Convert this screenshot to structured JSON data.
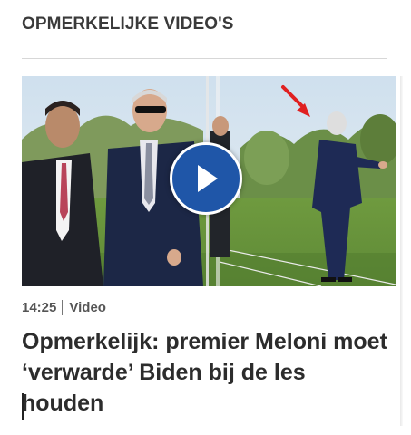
{
  "section": {
    "title": "OPMERKELIJKE VIDEO'S"
  },
  "video_card": {
    "duration": "14:25",
    "type_label": "Video",
    "headline": "Opmerkelijk: premier Meloni moet ‘verwarde’ Biden bij de les houden",
    "play_icon": "play-icon",
    "arrow_icon": "red-arrow-annotation"
  },
  "colors": {
    "accent_play": "#1f56a8",
    "annotation_arrow": "#e02020",
    "headline_text": "#2c2c2c"
  }
}
